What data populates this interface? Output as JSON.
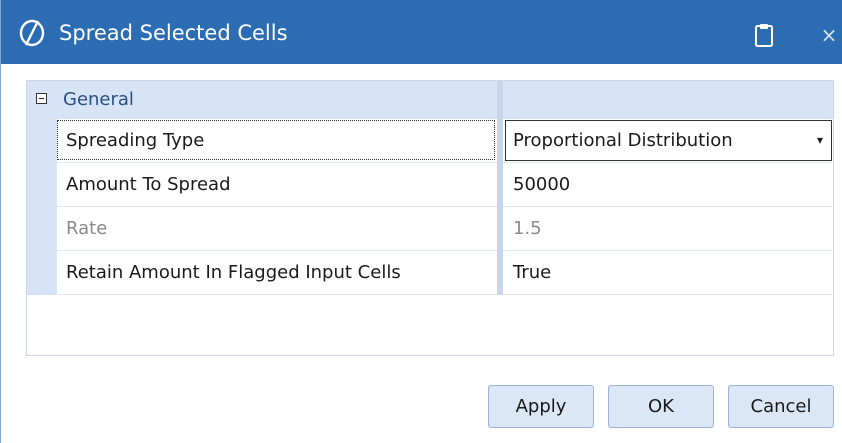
{
  "window": {
    "title": "Spread Selected Cells",
    "logo_icon": "onestream-logo-icon",
    "clipboard_icon": "clipboard-icon",
    "close_label": "×"
  },
  "property_grid": {
    "category": {
      "label": "General",
      "toggle_symbol": "collapse-icon"
    },
    "rows": [
      {
        "name": "Spreading Type",
        "value": "Proportional Distribution",
        "dropdown_arrow": "▾"
      },
      {
        "name": "Amount To Spread",
        "value": "50000"
      },
      {
        "name": "Rate",
        "value": "1.5"
      },
      {
        "name": "Retain Amount In Flagged Input Cells",
        "value": "True"
      }
    ]
  },
  "buttons": {
    "apply": "Apply",
    "ok": "OK",
    "cancel": "Cancel"
  },
  "colors": {
    "titlebar": "#2b6cb3",
    "category_band": "#d7e3f7",
    "button_bg": "#dbe6f6"
  }
}
